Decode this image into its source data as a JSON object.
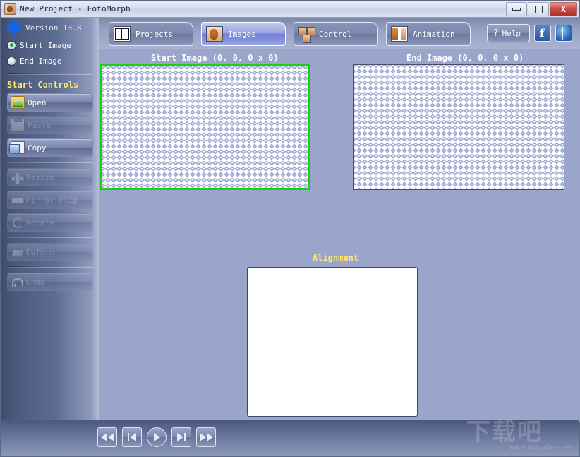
{
  "window": {
    "title": "New Project - FotoMorph",
    "icon": "app-photo-icon",
    "controls": {
      "minimize": "Minimize",
      "restore": "Restore",
      "close": "Close",
      "close_glyph": "X"
    }
  },
  "sidebar": {
    "version_label": "Version 13.8",
    "logo": "fotomorph-logo",
    "image_selector": [
      {
        "label": "Start Image",
        "selected": true
      },
      {
        "label": "End Image",
        "selected": false
      }
    ],
    "section_title": "Start Controls",
    "buttons": [
      {
        "label": "Open",
        "icon": "open-folder-icon",
        "enabled": true
      },
      {
        "label": "Paste",
        "icon": "paste-icon",
        "enabled": false
      },
      {
        "label": "Copy",
        "icon": "copy-icon",
        "enabled": true
      },
      {
        "label": "Resize",
        "icon": "resize-icon",
        "enabled": false
      },
      {
        "label": "Mirror Flip",
        "icon": "mirror-flip-icon",
        "enabled": false
      },
      {
        "label": "Rotate",
        "icon": "rotate-icon",
        "enabled": false
      },
      {
        "label": "Deform",
        "icon": "deform-icon",
        "enabled": false
      },
      {
        "label": "Undo",
        "icon": "undo-icon",
        "enabled": false
      }
    ]
  },
  "tabs": [
    {
      "label": "Projects",
      "icon": "projects-grid-icon",
      "active": false
    },
    {
      "label": "Images",
      "icon": "images-face-icon",
      "active": true
    },
    {
      "label": "Control",
      "icon": "control-nodes-icon",
      "active": false
    },
    {
      "label": "Animation",
      "icon": "animation-icon",
      "active": false
    }
  ],
  "toolbar_right": {
    "help_label": "Help",
    "help_glyph": "?",
    "facebook_glyph": "f",
    "facebook_name": "facebook-icon",
    "globe_name": "globe-icon"
  },
  "workspace": {
    "start_panel": {
      "label": "Start Image  (0, 0, 0 x 0)",
      "selected": true,
      "border_color": "#17d017"
    },
    "end_panel": {
      "label": "End Image  (0, 0, 0 x 0)",
      "selected": false,
      "border_color": "#46506e"
    },
    "alignment": {
      "label": "Alignment"
    }
  },
  "transport": [
    {
      "name": "first-frame-button",
      "glyph": "|<<"
    },
    {
      "name": "previous-frame-button",
      "glyph": "|<"
    },
    {
      "name": "play-button",
      "glyph": ">"
    },
    {
      "name": "next-frame-button",
      "glyph": ">|"
    },
    {
      "name": "last-frame-button",
      "glyph": ">>|"
    }
  ],
  "watermark": {
    "text": "下载吧",
    "url": "www.xiazaiba.com"
  },
  "colors": {
    "background": "#9ba4cb",
    "accent_yellow": "#ffe96a",
    "selection_green": "#17d017",
    "sidebar_dark": "#3f4c6e"
  }
}
